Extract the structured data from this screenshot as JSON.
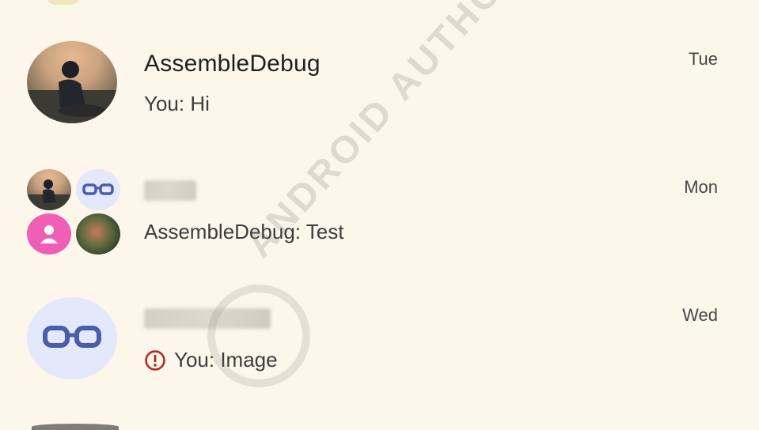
{
  "conversations": [
    {
      "name": "AssembleDebug",
      "preview": "You: Hi",
      "time": "Tue"
    },
    {
      "name": "",
      "preview": "AssembleDebug: Test",
      "time": "Mon"
    },
    {
      "name": "",
      "preview": "You: Image",
      "time": "Wed",
      "status": "error"
    }
  ],
  "watermark": "ANDROID AUTHORITY",
  "colors": {
    "background": "#fcf7ea",
    "error": "#b3261e",
    "avatar_tint": "#e3e8fb",
    "glasses": "#4a5ea8",
    "pink_avatar": "#ef5fb6"
  }
}
